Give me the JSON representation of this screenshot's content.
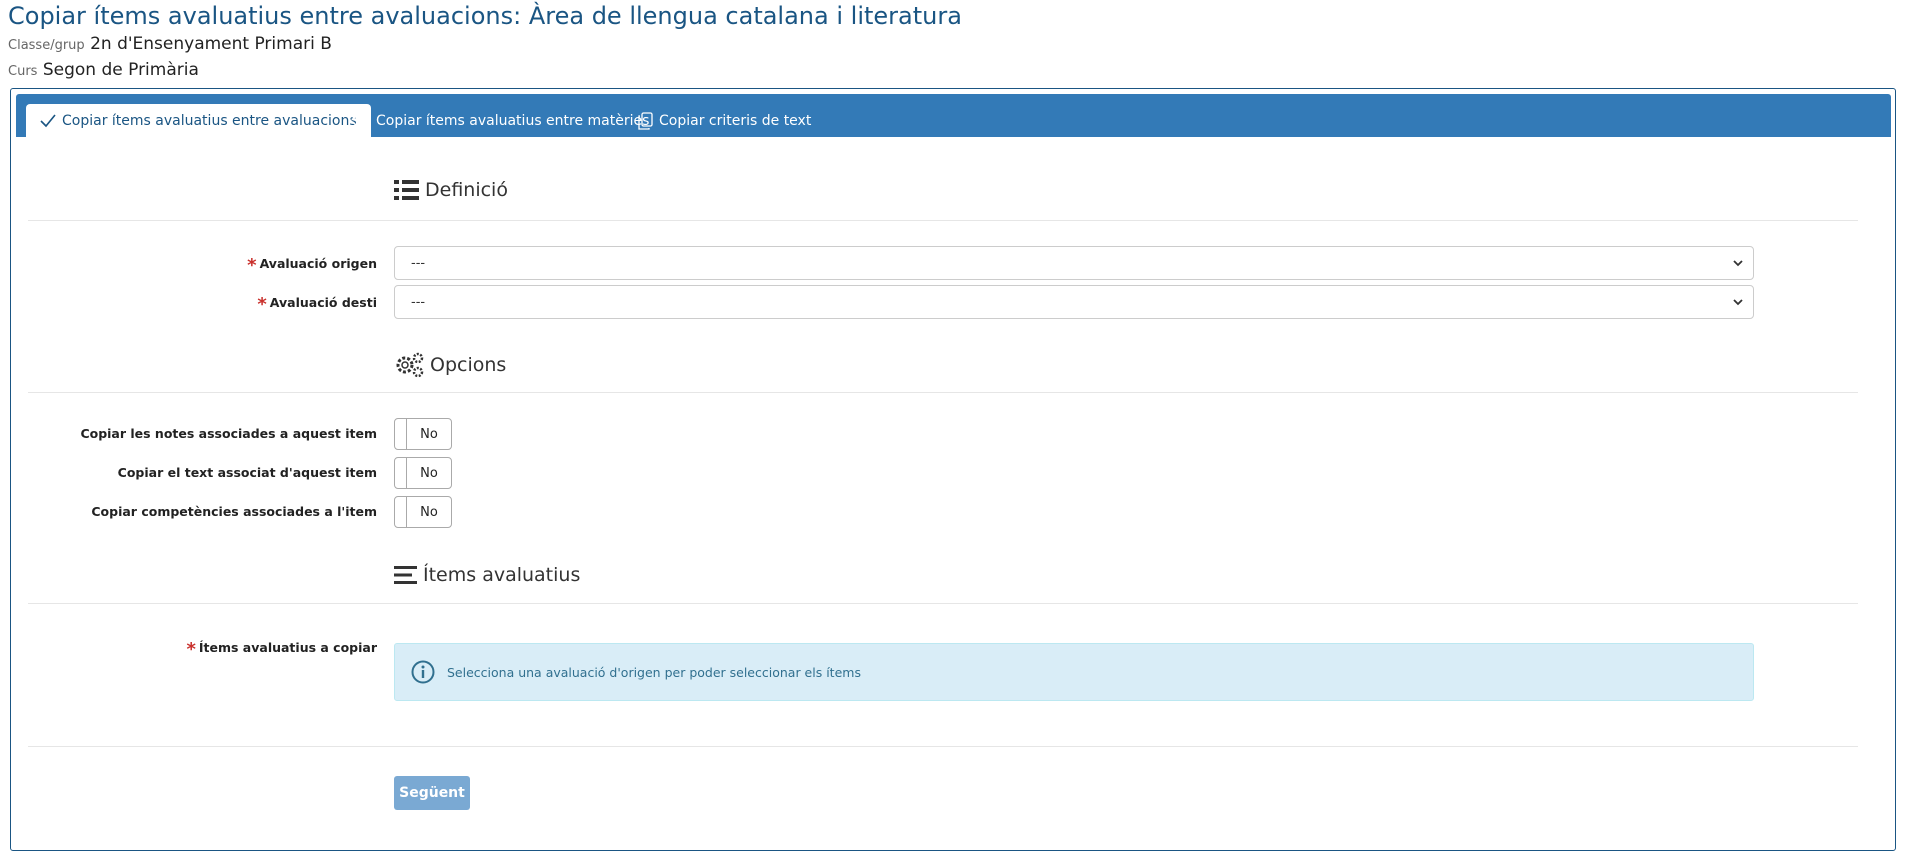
{
  "page": {
    "title": "Copiar ítems avaluatius entre avaluacions: Àrea de llengua catalana i literatura",
    "class_label": "Classe/grup",
    "class_value": "2n d'Ensenyament Primari B",
    "course_label": "Curs",
    "course_value": "Segon de Primària"
  },
  "tabs": [
    {
      "label": "Copiar ítems avaluatius entre avaluacions",
      "icon": "check-icon",
      "active": true
    },
    {
      "label": "Copiar ítems avaluatius entre matèries",
      "icon": "tag-icon",
      "active": false
    },
    {
      "label": "Copiar criteris de text",
      "icon": "copy-icon",
      "active": false
    }
  ],
  "sections": {
    "definicio": {
      "title": "Definició",
      "icon": "list-icon"
    },
    "opcions": {
      "title": "Opcions",
      "icon": "gears-icon"
    },
    "items": {
      "title": "Ítems avaluatius",
      "icon": "bars-icon"
    }
  },
  "fields": {
    "origen": {
      "label": "Avaluació origen",
      "value": "---",
      "required": true
    },
    "desti": {
      "label": "Avaluació desti",
      "value": "---",
      "required": true
    }
  },
  "options": [
    {
      "label": "Copiar les notes associades a aquest item",
      "value": "No"
    },
    {
      "label": "Copiar el text associat d'aquest item",
      "value": "No"
    },
    {
      "label": "Copiar competències associades a l'item",
      "value": "No"
    }
  ],
  "items_field": {
    "label": "Ítems avaluatius a copiar",
    "required": true,
    "info_text": "Selecciona una avaluació d'origen per poder seleccionar els ítems"
  },
  "buttons": {
    "next": "Següent"
  },
  "colors": {
    "primary": "#337ab7",
    "title": "#1a5583",
    "required": "#c9302c",
    "info_bg": "#d9edf7",
    "info_text": "#31708f",
    "button_disabled": "#7aa9d3"
  }
}
